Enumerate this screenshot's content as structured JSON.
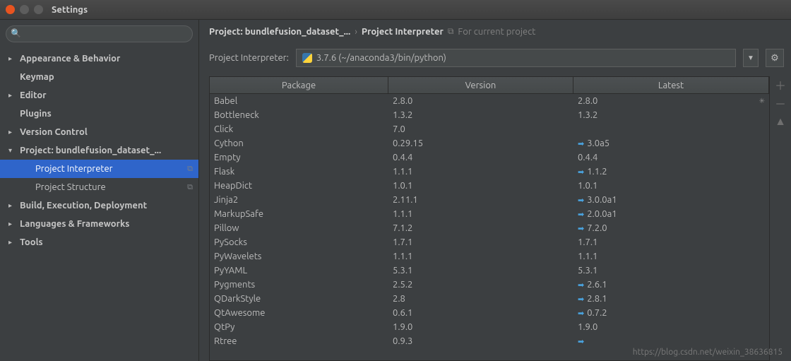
{
  "window": {
    "title": "Settings"
  },
  "sidebar": {
    "search_placeholder": "",
    "items": [
      {
        "label": "Appearance & Behavior",
        "level": 1,
        "state": "collapsed",
        "bold": true
      },
      {
        "label": "Keymap",
        "level": 1,
        "state": "noarrow",
        "bold": true
      },
      {
        "label": "Editor",
        "level": 1,
        "state": "collapsed",
        "bold": true
      },
      {
        "label": "Plugins",
        "level": 1,
        "state": "noarrow",
        "bold": true
      },
      {
        "label": "Version Control",
        "level": 1,
        "state": "collapsed",
        "bold": true
      },
      {
        "label": "Project: bundlefusion_dataset_...",
        "level": 1,
        "state": "expanded",
        "bold": true
      },
      {
        "label": "Project Interpreter",
        "level": 2,
        "state": "noarrow",
        "selected": true,
        "badge": "⧉"
      },
      {
        "label": "Project Structure",
        "level": 2,
        "state": "noarrow",
        "badge": "⧉"
      },
      {
        "label": "Build, Execution, Deployment",
        "level": 1,
        "state": "collapsed",
        "bold": true
      },
      {
        "label": "Languages & Frameworks",
        "level": 1,
        "state": "collapsed",
        "bold": true
      },
      {
        "label": "Tools",
        "level": 1,
        "state": "collapsed",
        "bold": true
      }
    ]
  },
  "breadcrumb": {
    "part1": "Project: bundlefusion_dataset_...",
    "part2": "Project Interpreter",
    "hint": "For current project"
  },
  "interpreter": {
    "label": "Project Interpreter:",
    "value": "3.7.6 (~/anaconda3/bin/python)"
  },
  "table": {
    "headers": {
      "pkg": "Package",
      "ver": "Version",
      "lat": "Latest"
    },
    "rows": [
      {
        "pkg": "Babel",
        "ver": "2.8.0",
        "lat": "2.8.0",
        "upgrade": false,
        "loading": true
      },
      {
        "pkg": "Bottleneck",
        "ver": "1.3.2",
        "lat": "1.3.2",
        "upgrade": false
      },
      {
        "pkg": "Click",
        "ver": "7.0",
        "lat": "",
        "upgrade": false
      },
      {
        "pkg": "Cython",
        "ver": "0.29.15",
        "lat": "3.0a5",
        "upgrade": true
      },
      {
        "pkg": "Empty",
        "ver": "0.4.4",
        "lat": "0.4.4",
        "upgrade": false
      },
      {
        "pkg": "Flask",
        "ver": "1.1.1",
        "lat": "1.1.2",
        "upgrade": true
      },
      {
        "pkg": "HeapDict",
        "ver": "1.0.1",
        "lat": "1.0.1",
        "upgrade": false
      },
      {
        "pkg": "Jinja2",
        "ver": "2.11.1",
        "lat": "3.0.0a1",
        "upgrade": true
      },
      {
        "pkg": "MarkupSafe",
        "ver": "1.1.1",
        "lat": "2.0.0a1",
        "upgrade": true
      },
      {
        "pkg": "Pillow",
        "ver": "7.1.2",
        "lat": "7.2.0",
        "upgrade": true
      },
      {
        "pkg": "PySocks",
        "ver": "1.7.1",
        "lat": "1.7.1",
        "upgrade": false
      },
      {
        "pkg": "PyWavelets",
        "ver": "1.1.1",
        "lat": "1.1.1",
        "upgrade": false
      },
      {
        "pkg": "PyYAML",
        "ver": "5.3.1",
        "lat": "5.3.1",
        "upgrade": false
      },
      {
        "pkg": "Pygments",
        "ver": "2.5.2",
        "lat": "2.6.1",
        "upgrade": true
      },
      {
        "pkg": "QDarkStyle",
        "ver": "2.8",
        "lat": "2.8.1",
        "upgrade": true
      },
      {
        "pkg": "QtAwesome",
        "ver": "0.6.1",
        "lat": "0.7.2",
        "upgrade": true
      },
      {
        "pkg": "QtPy",
        "ver": "1.9.0",
        "lat": "1.9.0",
        "upgrade": false
      },
      {
        "pkg": "Rtree",
        "ver": "0.9.3",
        "lat": "",
        "upgrade": true
      }
    ]
  },
  "watermark": "https://blog.csdn.net/weixin_38636815"
}
